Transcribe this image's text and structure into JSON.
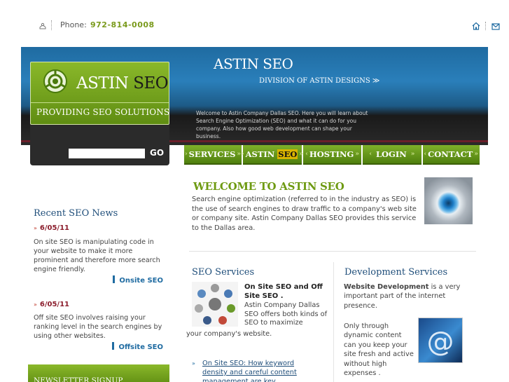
{
  "topbar": {
    "phone_label": "Phone:",
    "phone_number": "972-814-0008"
  },
  "header": {
    "logo_text_1": "ASTIN",
    "logo_text_2": "SEO",
    "tagline": "PROVIDING SEO SOLUTIONS",
    "site_title": "ASTIN SEO",
    "division": "DIVISION OF ASTIN DESIGNS ≫",
    "intro": "Welcome to Astin Company Dallas SEO. Here you will learn about Search Engine Optimization (SEO) and what it can do for you company. Also how good web development can shape your business.",
    "go_label": "GO",
    "search_value": ""
  },
  "nav": {
    "items": [
      {
        "label": "SERVICES"
      },
      {
        "label_a": "ASTIN",
        "label_b": "SEO"
      },
      {
        "label": "HOSTING"
      },
      {
        "label": "LOGIN"
      },
      {
        "label": "CONTACT"
      }
    ]
  },
  "sidebar": {
    "title": "Recent SEO News",
    "news": [
      {
        "date": "6/05/11",
        "text": "On site SEO is manipulating code in your website to make it more prominent and therefore more search engine friendly.",
        "link": "Onsite SEO"
      },
      {
        "date": "6/05/11",
        "text": "Off site SEO involves raising your ranking level in the search engines by using other websites.",
        "link": "Offsite SEO"
      }
    ],
    "newsletter": "NEWSLETTER SIGNUP"
  },
  "main": {
    "welcome_title": "WELCOME TO ASTIN SEO",
    "welcome_text": "Search engine optimization (referred to in the industry as SEO) is the use of search engines to draw traffic to a company's web site or company site. Astin Company Dallas SEO provides this service to the Dallas area.",
    "services_title": "SEO Services",
    "services_head": "On Site SEO and Off Site SEO .",
    "services_text_1": "Astin Company Dallas SEO offers both kinds of SEO to maximize",
    "services_text_2": "your company's website.",
    "services_link": "On Site SEO: How keyword density and careful content management are key",
    "dev_title": "Development Services",
    "dev_text_bold": "Website Development",
    "dev_text_1": " is a very important part of the internet presence.",
    "dev_text_2": "Only through dynamic content can you keep your site fresh and active without high expenses ."
  },
  "colors": {
    "accent_green": "#7a9a1c",
    "header_blue": "#1f6ba1",
    "news_date_red": "#8b1d2c"
  }
}
